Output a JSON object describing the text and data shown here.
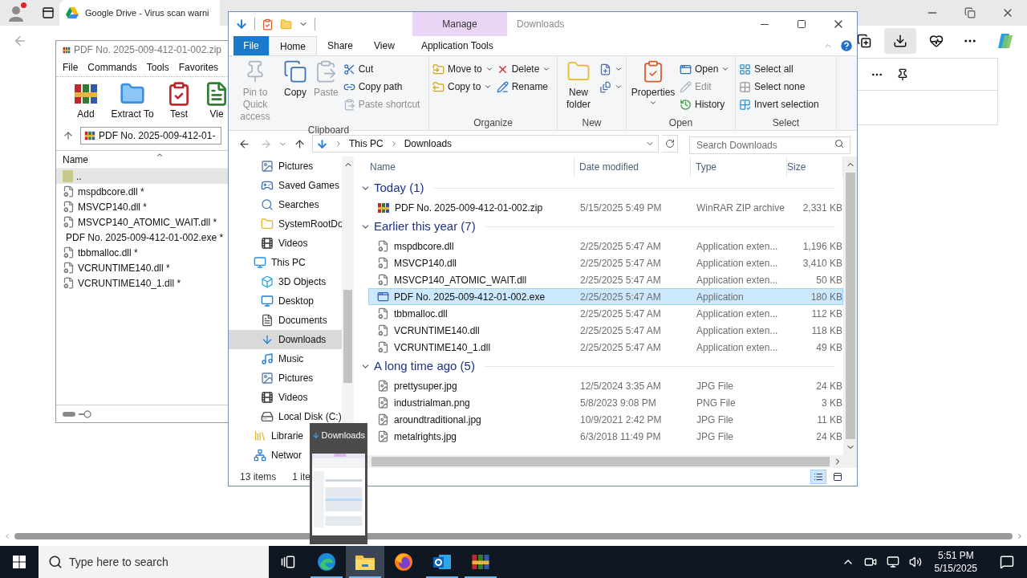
{
  "browser": {
    "tab_title": "Google Drive - Virus scan warni"
  },
  "winrar": {
    "title": "PDF No. 2025-009-412-01-002.zip",
    "menu": [
      "File",
      "Commands",
      "Tools",
      "Favorites"
    ],
    "tools": [
      "Add",
      "Extract To",
      "Test",
      "Vie"
    ],
    "path": "PDF No. 2025-009-412-01-",
    "column": "Name",
    "rows": [
      {
        "name": "..",
        "kind": "parent",
        "selected": true
      },
      {
        "name": "mspdbcore.dll *",
        "kind": "dll",
        "selected": false
      },
      {
        "name": "MSVCP140.dll *",
        "kind": "dll",
        "selected": false
      },
      {
        "name": "MSVCP140_ATOMIC_WAIT.dll *",
        "kind": "dll",
        "selected": false
      },
      {
        "name": "PDF No. 2025-009-412-01-002.exe *",
        "kind": "exe",
        "selected": false
      },
      {
        "name": "tbbmalloc.dll *",
        "kind": "dll",
        "selected": false
      },
      {
        "name": "VCRUNTIME140.dll *",
        "kind": "dll",
        "selected": false
      },
      {
        "name": "VCRUNTIME140_1.dll *",
        "kind": "dll",
        "selected": false
      }
    ]
  },
  "explorer": {
    "context_tab_group": "Manage",
    "title": "Downloads",
    "tabs": [
      {
        "label": "File",
        "kind": "file",
        "selected": false
      },
      {
        "label": "Home",
        "kind": "tab",
        "selected": true
      },
      {
        "label": "Share",
        "kind": "tab",
        "selected": false
      },
      {
        "label": "View",
        "kind": "tab",
        "selected": false
      },
      {
        "label": "Application Tools",
        "kind": "context",
        "selected": false
      }
    ],
    "ribbon": [
      {
        "label": "Clipboard",
        "columns": [
          {
            "kind": "large",
            "items": [
              {
                "label": "Pin to Quick access",
                "disabled": true,
                "dropdown": false
              }
            ]
          },
          {
            "kind": "large",
            "items": [
              {
                "label": "Copy",
                "disabled": false,
                "dropdown": false
              }
            ]
          },
          {
            "kind": "large",
            "items": [
              {
                "label": "Paste",
                "disabled": true,
                "dropdown": false
              }
            ]
          },
          {
            "kind": "stack",
            "items": [
              {
                "label": "Cut",
                "disabled": false,
                "dropdown": false
              },
              {
                "label": "Copy path",
                "disabled": false,
                "dropdown": false
              },
              {
                "label": "Paste shortcut",
                "disabled": true,
                "dropdown": false
              }
            ]
          }
        ]
      },
      {
        "label": "Organize",
        "columns": [
          {
            "kind": "stack",
            "items": [
              {
                "label": "Move to",
                "disabled": false,
                "dropdown": true
              },
              {
                "label": "Copy to",
                "disabled": false,
                "dropdown": true
              }
            ]
          },
          {
            "kind": "stack",
            "items": [
              {
                "label": "Delete",
                "disabled": false,
                "dropdown": true
              },
              {
                "label": "Rename",
                "disabled": false,
                "dropdown": false
              }
            ]
          }
        ]
      },
      {
        "label": "New",
        "columns": [
          {
            "kind": "large",
            "items": [
              {
                "label": "New folder",
                "disabled": false,
                "dropdown": false
              }
            ]
          },
          {
            "kind": "stack",
            "items": [
              {
                "disabled": false,
                "dropdown": true
              },
              {
                "disabled": false,
                "dropdown": true
              }
            ]
          }
        ]
      },
      {
        "label": "Open",
        "columns": [
          {
            "kind": "large",
            "items": [
              {
                "label": "Properties",
                "disabled": false,
                "dropdown": true
              }
            ]
          },
          {
            "kind": "stack",
            "items": [
              {
                "label": "Open",
                "disabled": false,
                "dropdown": true
              },
              {
                "label": "Edit",
                "disabled": true,
                "dropdown": false
              },
              {
                "label": "History",
                "disabled": false,
                "dropdown": false
              }
            ]
          }
        ]
      },
      {
        "label": "Select",
        "columns": [
          {
            "kind": "stack",
            "items": [
              {
                "label": "Select all",
                "disabled": false,
                "dropdown": false
              },
              {
                "label": "Select none",
                "disabled": false,
                "dropdown": false
              },
              {
                "label": "Invert selection",
                "disabled": false,
                "dropdown": false
              }
            ]
          }
        ]
      }
    ],
    "address": {
      "crumbs": [
        "This PC",
        "Downloads"
      ]
    },
    "search": {
      "placeholder": "Search Downloads"
    },
    "nav": {
      "items": [
        {
          "label": "Pictures",
          "selected": false
        },
        {
          "label": "Saved Games",
          "selected": false
        },
        {
          "label": "Searches",
          "selected": false
        },
        {
          "label": "SystemRootDo",
          "selected": false
        },
        {
          "label": "Videos",
          "selected": false
        }
      ],
      "tree": [
        {
          "label": "This PC",
          "selected": false,
          "children": [
            {
              "label": "3D Objects",
              "selected": false
            },
            {
              "label": "Desktop",
              "selected": false
            },
            {
              "label": "Documents",
              "selected": false
            },
            {
              "label": "Downloads",
              "selected": true
            },
            {
              "label": "Music",
              "selected": false
            },
            {
              "label": "Pictures",
              "selected": false
            },
            {
              "label": "Videos",
              "selected": false
            },
            {
              "label": "Local Disk (C:)",
              "selected": false
            }
          ]
        },
        {
          "label": "Librarie",
          "selected": false
        },
        {
          "label": "Networ",
          "selected": false
        }
      ]
    },
    "columns": [
      "Name",
      "Date modified",
      "Type",
      "Size"
    ],
    "groups": [
      {
        "title": "Today (1)",
        "expanded": true,
        "rows": [
          {
            "name": "PDF No. 2025-009-412-01-002.zip",
            "date": "5/15/2025 5:49 PM",
            "type": "WinRAR ZIP archive",
            "size": "2,331 KB",
            "kind": "archive",
            "selected": false
          }
        ]
      },
      {
        "title": "Earlier this year (7)",
        "expanded": true,
        "rows": [
          {
            "name": "mspdbcore.dll",
            "date": "2/25/2025 5:47 AM",
            "type": "Application exten...",
            "size": "1,196 KB",
            "kind": "dll",
            "selected": false
          },
          {
            "name": "MSVCP140.dll",
            "date": "2/25/2025 5:47 AM",
            "type": "Application exten...",
            "size": "3,410 KB",
            "kind": "dll",
            "selected": false
          },
          {
            "name": "MSVCP140_ATOMIC_WAIT.dll",
            "date": "2/25/2025 5:47 AM",
            "type": "Application exten...",
            "size": "50 KB",
            "kind": "dll",
            "selected": false
          },
          {
            "name": "PDF No. 2025-009-412-01-002.exe",
            "date": "2/25/2025 5:47 AM",
            "type": "Application",
            "size": "180 KB",
            "kind": "exe",
            "selected": true
          },
          {
            "name": "tbbmalloc.dll",
            "date": "2/25/2025 5:47 AM",
            "type": "Application exten...",
            "size": "112 KB",
            "kind": "dll",
            "selected": false
          },
          {
            "name": "VCRUNTIME140.dll",
            "date": "2/25/2025 5:47 AM",
            "type": "Application exten...",
            "size": "118 KB",
            "kind": "dll",
            "selected": false
          },
          {
            "name": "VCRUNTIME140_1.dll",
            "date": "2/25/2025 5:47 AM",
            "type": "Application exten...",
            "size": "49 KB",
            "kind": "dll",
            "selected": false
          }
        ]
      },
      {
        "title": "A long time ago (5)",
        "expanded": true,
        "rows": [
          {
            "name": "prettysuper.jpg",
            "date": "12/5/2024 3:35 AM",
            "type": "JPG File",
            "size": "24 KB",
            "kind": "image",
            "selected": false
          },
          {
            "name": "industrialman.png",
            "date": "5/8/2023 9:08 PM",
            "type": "PNG File",
            "size": "3 KB",
            "kind": "image",
            "selected": false
          },
          {
            "name": "aroundtraditional.jpg",
            "date": "10/9/2021 2:42 PM",
            "type": "JPG File",
            "size": "11 KB",
            "kind": "image",
            "selected": false
          },
          {
            "name": "metalrights.jpg",
            "date": "6/3/2018 11:49 PM",
            "type": "JPG File",
            "size": "24 KB",
            "kind": "image",
            "selected": false
          }
        ]
      }
    ],
    "status": {
      "count": "13 items",
      "selection": "1 ite"
    }
  },
  "popup": {
    "title": "Downloads"
  },
  "taskbar": {
    "search": {
      "placeholder": "Type here to search"
    },
    "apps": [
      {
        "kind": "edge",
        "active": false,
        "running": true
      },
      {
        "kind": "explorer",
        "active": true,
        "running": true
      },
      {
        "kind": "firefox",
        "active": false,
        "running": false
      },
      {
        "kind": "outlook",
        "active": false,
        "running": true
      },
      {
        "kind": "winrar",
        "active": false,
        "running": true
      }
    ],
    "time": "5:51 PM",
    "date": "5/15/2025"
  }
}
